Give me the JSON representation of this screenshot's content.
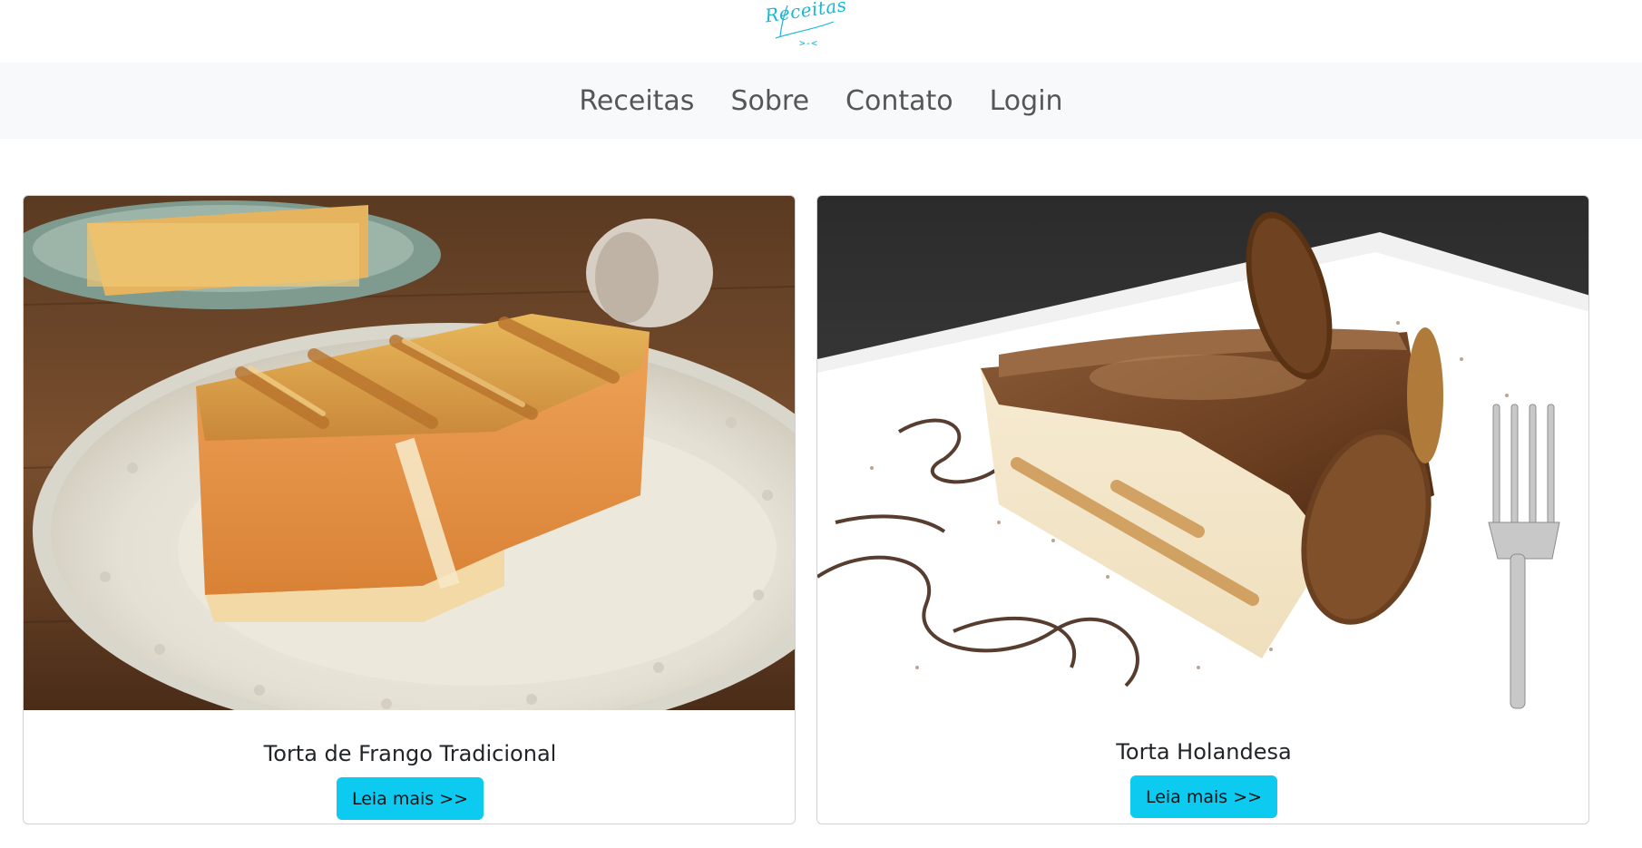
{
  "header": {
    "logo_text": "Receitas",
    "logo_accent": ">-<",
    "logo_color": "#17b8d6"
  },
  "nav": {
    "items": [
      {
        "label": "Receitas"
      },
      {
        "label": "Sobre"
      },
      {
        "label": "Contato"
      },
      {
        "label": "Login"
      }
    ]
  },
  "cards": [
    {
      "title": "Torta de Frango Tradicional",
      "button_label": "Leia mais >>",
      "image": "chicken-pie-photo"
    },
    {
      "title": "Torta Holandesa",
      "button_label": "Leia mais >>",
      "image": "dutch-pie-photo"
    }
  ],
  "colors": {
    "button": "#0dcaf0",
    "navbar_bg": "#f8f9fa",
    "nav_text": "#565656"
  }
}
